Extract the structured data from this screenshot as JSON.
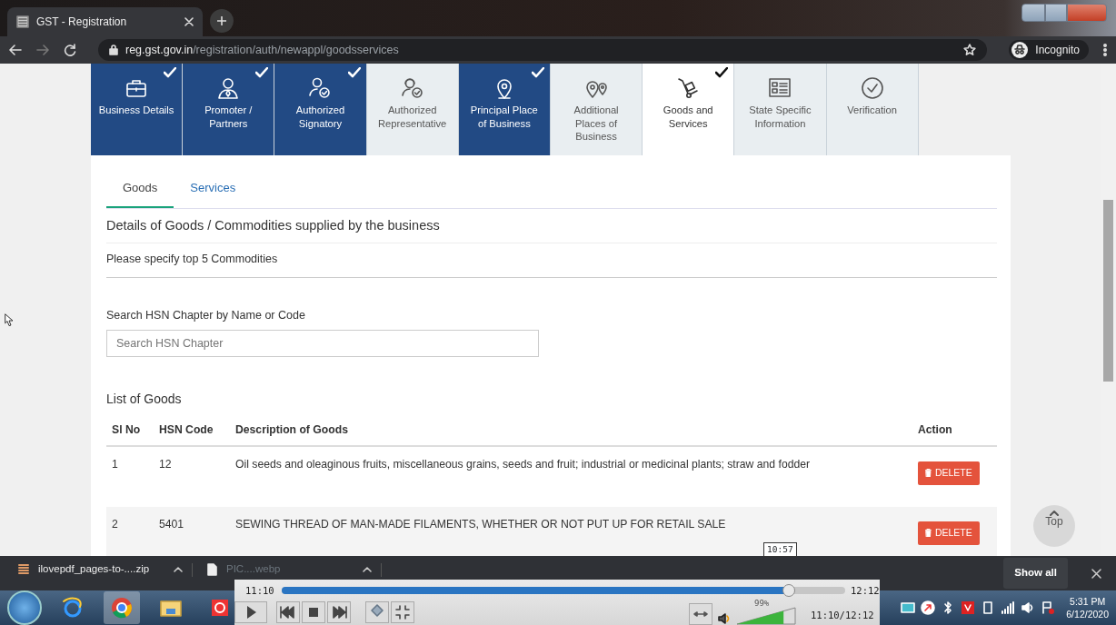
{
  "browser": {
    "tab_title": "GST - Registration",
    "url_host": "reg.gst.gov.in",
    "url_path": "/registration/auth/newappl/goodsservices",
    "profile": "Incognito"
  },
  "steps": [
    {
      "label": "Business Details",
      "completed": true,
      "checked": true,
      "selected": false
    },
    {
      "label": "Promoter / Partners",
      "completed": true,
      "checked": true,
      "selected": false
    },
    {
      "label": "Authorized Signatory",
      "completed": true,
      "checked": true,
      "selected": false
    },
    {
      "label": "Authorized Representative",
      "completed": false,
      "checked": false,
      "selected": false
    },
    {
      "label": "Principal Place of Business",
      "completed": true,
      "checked": true,
      "selected": false
    },
    {
      "label": "Additional Places of Business",
      "completed": false,
      "checked": false,
      "selected": false
    },
    {
      "label": "Goods and Services",
      "completed": false,
      "checked": true,
      "selected": true
    },
    {
      "label": "State Specific Information",
      "completed": false,
      "checked": false,
      "selected": false
    },
    {
      "label": "Verification",
      "completed": false,
      "checked": false,
      "selected": false
    }
  ],
  "tabs": [
    {
      "label": "Goods",
      "selected": true
    },
    {
      "label": "Services",
      "selected": false
    }
  ],
  "section_title": "Details of Goods / Commodities supplied by the business",
  "instruction": "Please specify top 5 Commodities",
  "search": {
    "label": "Search HSN Chapter by Name or Code",
    "placeholder": "Search HSN Chapter"
  },
  "list_title": "List of Goods",
  "table": {
    "columns": [
      "Sl No",
      "HSN Code",
      "Description of Goods",
      "Action"
    ],
    "rows": [
      {
        "sl_no": "1",
        "hsn_code": "12",
        "description": "Oil seeds and oleaginous fruits, miscellaneous grains, seeds and fruit; industrial or medicinal plants; straw and fodder",
        "action": "DELETE"
      },
      {
        "sl_no": "2",
        "hsn_code": "5401",
        "description": "SEWING THREAD OF MAN-MADE FILAMENTS, WHETHER OR NOT PUT UP FOR RETAIL SALE",
        "action": "DELETE"
      }
    ]
  },
  "top_button": "Top",
  "downloads": {
    "items": [
      {
        "name": "ilovepdf_pages-to-....zip"
      },
      {
        "name": "PIC....webp"
      }
    ],
    "show_all": "Show all"
  },
  "player": {
    "tooltip": "10:57",
    "elapsed": "11:10",
    "total": "12:12",
    "level": 0.9,
    "volume": {
      "reading": "99%",
      "level": 0.8
    },
    "time_readout": "11:10/12:12"
  },
  "taskbar": {
    "time": "5:31 PM",
    "date": "6/12/2020"
  }
}
